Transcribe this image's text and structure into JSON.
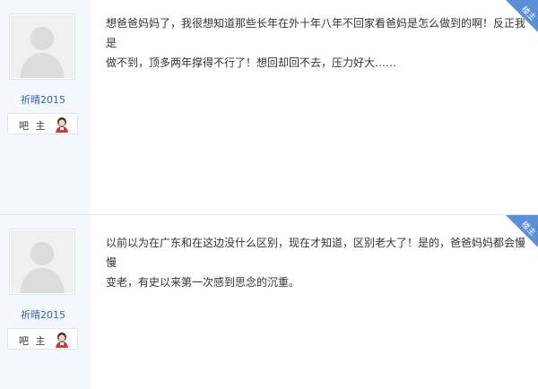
{
  "posts": [
    {
      "username": "祈晴2015",
      "role": "吧 主",
      "badge": "楼主",
      "content_line1": "想爸爸妈妈了，我很想知道那些长年在外十年八年不回家看爸妈是怎么做到的啊！反正我是",
      "content_line2": "做不到，顶多两年撑得不行了！想回却回不去，压力好大……"
    },
    {
      "username": "祈晴2015",
      "role": "吧 主",
      "badge": "楼主",
      "content_line1": "以前以为在广东和在这边没什么区别，现在才知道，区别老大了！是的，爸爸妈妈都会慢慢",
      "content_line2": "变老，有史以来第一次感到思念的沉重。"
    }
  ],
  "colors": {
    "sidebar_bg": "#f4f7fb",
    "username": "#2d64b3",
    "badge_bg": "#5b8fd8"
  }
}
